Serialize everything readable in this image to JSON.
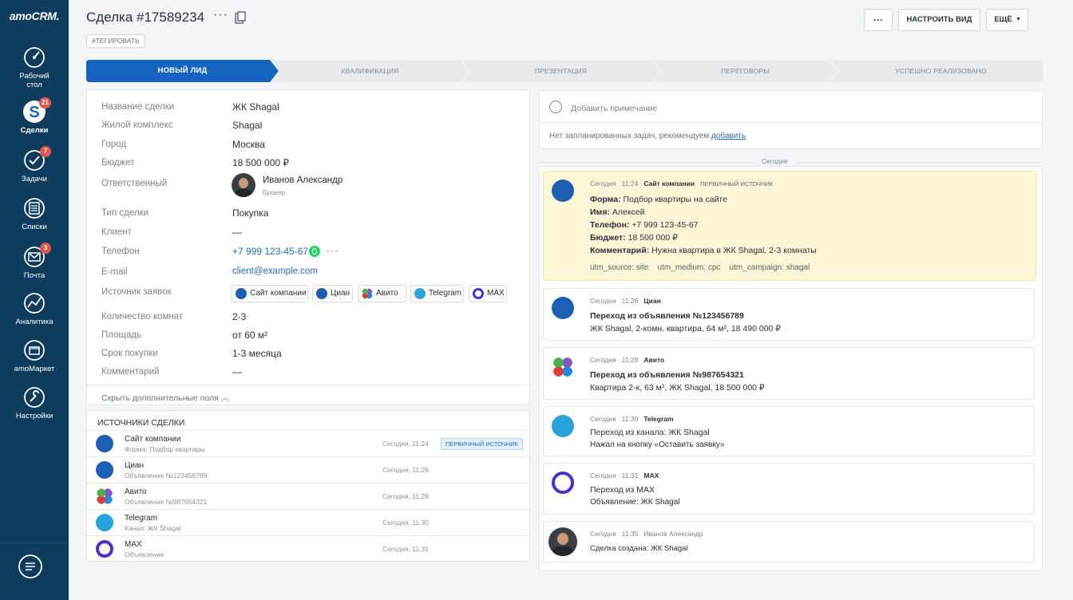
{
  "sidebar": {
    "logo": "amoCRM.",
    "items": [
      {
        "label": "Рабочий стол",
        "icon": "dashboard-icon",
        "badge": ""
      },
      {
        "label": "Сделки",
        "icon": "deals-icon",
        "badge": "21"
      },
      {
        "label": "Задачи",
        "icon": "tasks-icon",
        "badge": "7"
      },
      {
        "label": "Списки",
        "icon": "lists-icon",
        "badge": ""
      },
      {
        "label": "Почта",
        "icon": "mail-icon",
        "badge": "3"
      },
      {
        "label": "Аналитика",
        "icon": "analytics-icon",
        "badge": ""
      },
      {
        "label": "amoМаркет",
        "icon": "market-icon",
        "badge": ""
      },
      {
        "label": "Настройки",
        "icon": "settings-icon",
        "badge": ""
      }
    ]
  },
  "header": {
    "title": "Сделка #17589234",
    "tag_button": "#ТЕГИРОВАТЬ",
    "more_label": "···",
    "configure_label": "НАСТРОИТЬ ВИД",
    "more_menu_label": "ЕЩЁ"
  },
  "pipeline": {
    "stages": [
      "НОВЫЙ ЛИД",
      "КВАЛИФИКАЦИЯ",
      "ПРЕЗЕНТАЦИЯ",
      "ПЕРЕГОВОРЫ",
      "УСПЕШНО РЕАЛИЗОВАНО"
    ],
    "active_index": 0,
    "active_color": "#1565c0"
  },
  "fields": {
    "deal_name": {
      "label": "Название сделки",
      "value": "ЖК Shagal"
    },
    "complex": {
      "label": "Жилой комплекс",
      "value": "Shagal"
    },
    "city": {
      "label": "Город",
      "value": "Москва"
    },
    "budget": {
      "label": "Бюджет",
      "value": "18 500 000 ₽"
    },
    "responsible": {
      "label": "Ответственный",
      "name": "Иванов Александр",
      "role": "Брокер"
    },
    "deal_type": {
      "label": "Тип сделки",
      "value": "Покупка"
    },
    "client": {
      "label": "Клиент",
      "value": "—"
    },
    "phone": {
      "label": "Телефон",
      "value": "+7 999 123-45-67"
    },
    "email": {
      "label": "E-mail",
      "value": "client@example.com"
    },
    "sources": {
      "label": "Источник заявок",
      "chips": [
        "Сайт компании",
        "Циан",
        "Авито",
        "Telegram",
        "MAX"
      ]
    },
    "rooms": {
      "label": "Количество комнат",
      "value": "2-3"
    },
    "area": {
      "label": "Площадь",
      "value": "от 60 м²"
    },
    "term": {
      "label": "Срок покупки",
      "value": "1-3 месяца"
    },
    "comment": {
      "label": "Комментарий",
      "value": "—"
    },
    "hide_label": "Скрыть дополнительные поля"
  },
  "sources_panel": {
    "title": "ИСТОЧНИКИ СДЕЛКИ",
    "primary_label": "ПЕРВИЧНЫЙ ИСТОЧНИК",
    "rows": [
      {
        "name": "Сайт компании",
        "sub": "Форма: Подбор квартиры",
        "time": "Сегодня, 11:24"
      },
      {
        "name": "Циан",
        "sub": "Объявление №123456789",
        "time": "Сегодня, 11:26"
      },
      {
        "name": "Авито",
        "sub": "Объявление №987654321",
        "time": "Сегодня, 11:28"
      },
      {
        "name": "Telegram",
        "sub": "Канал: ЖК Shagal",
        "time": "Сегодня, 11:30"
      },
      {
        "name": "MAX",
        "sub": "Объявление",
        "time": "Сегодня, 11:31"
      }
    ]
  },
  "notes": {
    "add_note": "Добавить примечание",
    "no_tasks": "Нет запланированных задач, рекомендуем",
    "add_link": "добавить",
    "today": "Сегодня"
  },
  "feed": {
    "site": {
      "day": "Сегодня",
      "time": "11:24",
      "source": "Сайт компании",
      "tag": "ПЕРВИЧНЫЙ ИСТОЧНИК",
      "lines": [
        {
          "k": "Форма:",
          "v": "Подбор квартиры на сайте"
        },
        {
          "k": "Имя:",
          "v": "Алексей"
        },
        {
          "k": "Телефон:",
          "v": "+7 999 123-45-67"
        },
        {
          "k": "Бюджет:",
          "v": "18 500 000 ₽"
        },
        {
          "k": "Комментарий:",
          "v": "Нужна квартира в ЖК Shagal, 2-3 комнаты"
        }
      ],
      "utm": [
        "utm_source: site",
        "utm_medium: cpc",
        "utm_campaign: shagal"
      ]
    },
    "cian": {
      "day": "Сегодня",
      "time": "11:26",
      "source": "Циан",
      "head": "Переход из объявления №123456789",
      "text": "ЖК Shagal, 2-комн. квартира, 64 м², 18 490 000 ₽"
    },
    "avito": {
      "day": "Сегодня",
      "time": "11:28",
      "source": "Авито",
      "head": "Переход из объявления №987654321",
      "text": "Квартира 2-к, 63 м², ЖК Shagal, 18 500 000 ₽"
    },
    "telegram": {
      "day": "Сегодня",
      "time": "11:30",
      "source": "Telegram",
      "head": "Переход из канала: ЖК Shagal",
      "text": "Нажал на кнопку «Оставить заявку»"
    },
    "max": {
      "day": "Сегодня",
      "time": "11:31",
      "source": "MAX",
      "head": "Переход из MAX",
      "text": "Объявление: ЖК Shagal"
    },
    "created": {
      "day": "Сегодня",
      "time": "11:35",
      "source": "Иванов Александр",
      "text": "Сделка создана: ЖК Shagal"
    }
  }
}
